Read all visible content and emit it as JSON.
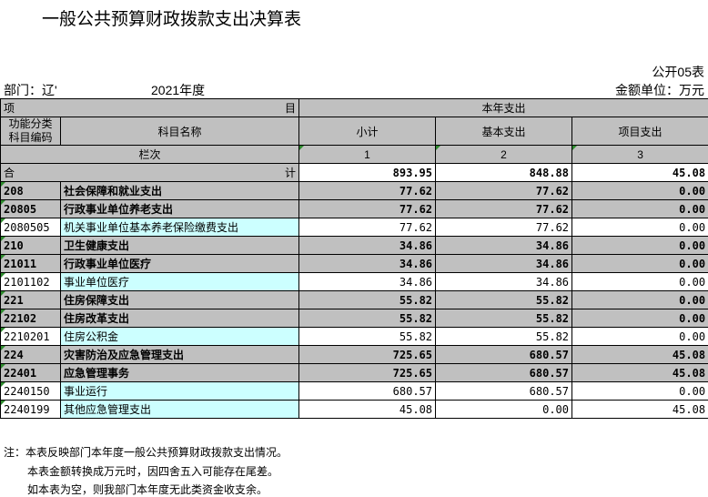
{
  "title": "一般公共预算财政拨款支出决算表",
  "form_code": "公开05表",
  "dept_label": "部门：辽'",
  "year": "2021年度",
  "unit": "金额单位：万元",
  "header": {
    "xiang": "项",
    "mu": "目",
    "current": "本年支出",
    "code_col": "功能分类\n科目编码",
    "name_col": "科目名称",
    "subtotal": "小计",
    "basic": "基本支出",
    "project": "项目支出",
    "lanci": "栏次",
    "col1": "1",
    "col2": "2",
    "col3": "3"
  },
  "total": {
    "he": "合",
    "ji": "计",
    "subtotal": "893.95",
    "basic": "848.88",
    "project": "45.08"
  },
  "rows": [
    {
      "code": "208",
      "name": "社会保障和就业支出",
      "subtotal": "77.62",
      "basic": "77.62",
      "project": "0.00",
      "level": 1
    },
    {
      "code": "20805",
      "name": "行政事业单位养老支出",
      "subtotal": "77.62",
      "basic": "77.62",
      "project": "0.00",
      "level": 2
    },
    {
      "code": "2080505",
      "name": "机关事业单位基本养老保险缴费支出",
      "subtotal": "77.62",
      "basic": "77.62",
      "project": "0.00",
      "level": 3
    },
    {
      "code": "210",
      "name": "卫生健康支出",
      "subtotal": "34.86",
      "basic": "34.86",
      "project": "0.00",
      "level": 1
    },
    {
      "code": "21011",
      "name": "行政事业单位医疗",
      "subtotal": "34.86",
      "basic": "34.86",
      "project": "0.00",
      "level": 2
    },
    {
      "code": "2101102",
      "name": "事业单位医疗",
      "subtotal": "34.86",
      "basic": "34.86",
      "project": "0.00",
      "level": 3
    },
    {
      "code": "221",
      "name": "住房保障支出",
      "subtotal": "55.82",
      "basic": "55.82",
      "project": "0.00",
      "level": 1
    },
    {
      "code": "22102",
      "name": "住房改革支出",
      "subtotal": "55.82",
      "basic": "55.82",
      "project": "0.00",
      "level": 2
    },
    {
      "code": "2210201",
      "name": "住房公积金",
      "subtotal": "55.82",
      "basic": "55.82",
      "project": "0.00",
      "level": 3
    },
    {
      "code": "224",
      "name": "灾害防治及应急管理支出",
      "subtotal": "725.65",
      "basic": "680.57",
      "project": "45.08",
      "level": 1
    },
    {
      "code": "22401",
      "name": "应急管理事务",
      "subtotal": "725.65",
      "basic": "680.57",
      "project": "45.08",
      "level": 2
    },
    {
      "code": "2240150",
      "name": "事业运行",
      "subtotal": "680.57",
      "basic": "680.57",
      "project": "0.00",
      "level": 3
    },
    {
      "code": "2240199",
      "name": "其他应急管理支出",
      "subtotal": "45.08",
      "basic": "0.00",
      "project": "45.08",
      "level": 3
    }
  ],
  "notes": [
    "注：本表反映部门本年度一般公共预算财政拨款支出情况。",
    "本表金额转换成万元时，因四舍五入可能存在尾差。",
    "如本表为空，则我部门本年度无此类资金收支余。"
  ]
}
